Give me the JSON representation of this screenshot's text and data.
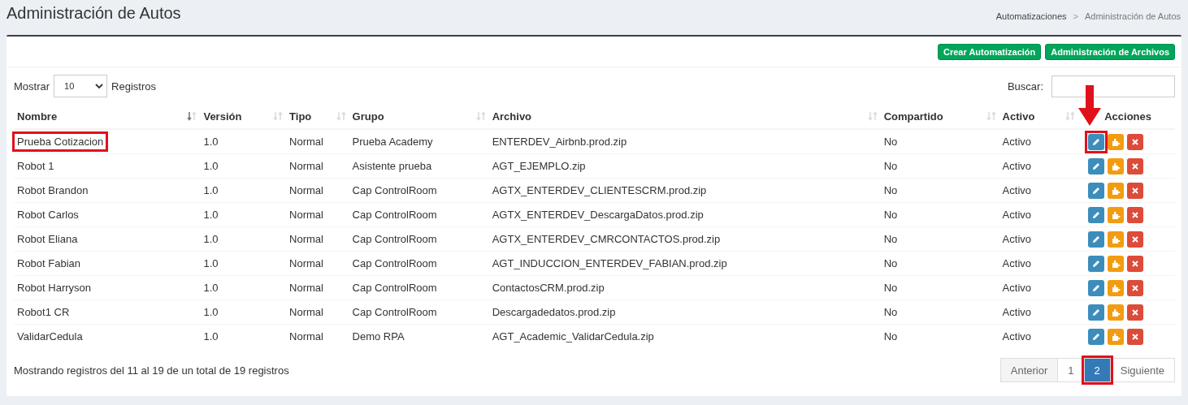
{
  "page_title": "Administración de Autos",
  "breadcrumb": [
    {
      "label": "Automatizaciones",
      "active": false
    },
    {
      "label": "Administración de Autos",
      "active": true
    }
  ],
  "breadcrumb_separator": ">",
  "toolbar_buttons": [
    "Crear Automatización",
    "Administración de Archivos"
  ],
  "length_menu": {
    "before": "Mostrar",
    "value": "10",
    "after": "Registros"
  },
  "search": {
    "label": "Buscar:"
  },
  "columns": [
    {
      "label": "Nombre",
      "sorted": true
    },
    {
      "label": "Versión",
      "sorted": false
    },
    {
      "label": "Tipo",
      "sorted": false
    },
    {
      "label": "Grupo",
      "sorted": false
    },
    {
      "label": "Archivo",
      "sorted": false
    },
    {
      "label": "Compartido",
      "sorted": false
    },
    {
      "label": "Activo",
      "sorted": false
    },
    {
      "label": "Acciones"
    }
  ],
  "rows": [
    {
      "cells": [
        "Prueba Cotizacion",
        "1.0",
        "Normal",
        "Prueba Academy",
        "ENTERDEV_Airbnb.prod.zip",
        "No",
        "Activo"
      ],
      "highlight_name": true,
      "highlight_edit": true
    },
    {
      "cells": [
        "Robot 1",
        "1.0",
        "Normal",
        "Asistente prueba",
        "AGT_EJEMPLO.zip",
        "No",
        "Activo"
      ],
      "highlight_name": false,
      "highlight_edit": false
    },
    {
      "cells": [
        "Robot Brandon",
        "1.0",
        "Normal",
        "Cap ControlRoom",
        "AGTX_ENTERDEV_CLIENTESCRM.prod.zip",
        "No",
        "Activo"
      ],
      "highlight_name": false,
      "highlight_edit": false
    },
    {
      "cells": [
        "Robot Carlos",
        "1.0",
        "Normal",
        "Cap ControlRoom",
        "AGTX_ENTERDEV_DescargaDatos.prod.zip",
        "No",
        "Activo"
      ],
      "highlight_name": false,
      "highlight_edit": false
    },
    {
      "cells": [
        "Robot Eliana",
        "1.0",
        "Normal",
        "Cap ControlRoom",
        "AGTX_ENTERDEV_CMRCONTACTOS.prod.zip",
        "No",
        "Activo"
      ],
      "highlight_name": false,
      "highlight_edit": false
    },
    {
      "cells": [
        "Robot Fabian",
        "1.0",
        "Normal",
        "Cap ControlRoom",
        "AGT_INDUCCION_ENTERDEV_FABIAN.prod.zip",
        "No",
        "Activo"
      ],
      "highlight_name": false,
      "highlight_edit": false
    },
    {
      "cells": [
        "Robot Harryson",
        "1.0",
        "Normal",
        "Cap ControlRoom",
        "ContactosCRM.prod.zip",
        "No",
        "Activo"
      ],
      "highlight_name": false,
      "highlight_edit": false
    },
    {
      "cells": [
        "Robot1 CR",
        "1.0",
        "Normal",
        "Cap ControlRoom",
        "Descargadedatos.prod.zip",
        "No",
        "Activo"
      ],
      "highlight_name": false,
      "highlight_edit": false
    },
    {
      "cells": [
        "ValidarCedula",
        "1.0",
        "Normal",
        "Demo RPA",
        "AGT_Academic_ValidarCedula.zip",
        "No",
        "Activo"
      ],
      "highlight_name": false,
      "highlight_edit": false
    }
  ],
  "info": "Mostrando registros del 11 al 19 de un total de 19 registros",
  "pagination": [
    {
      "label": "Anterior",
      "selected": false,
      "highlighted": false
    },
    {
      "label": "1",
      "selected": false,
      "highlighted": false
    },
    {
      "label": "2",
      "selected": true,
      "highlighted": true
    },
    {
      "label": "Siguiente",
      "selected": false,
      "highlighted": false
    }
  ]
}
